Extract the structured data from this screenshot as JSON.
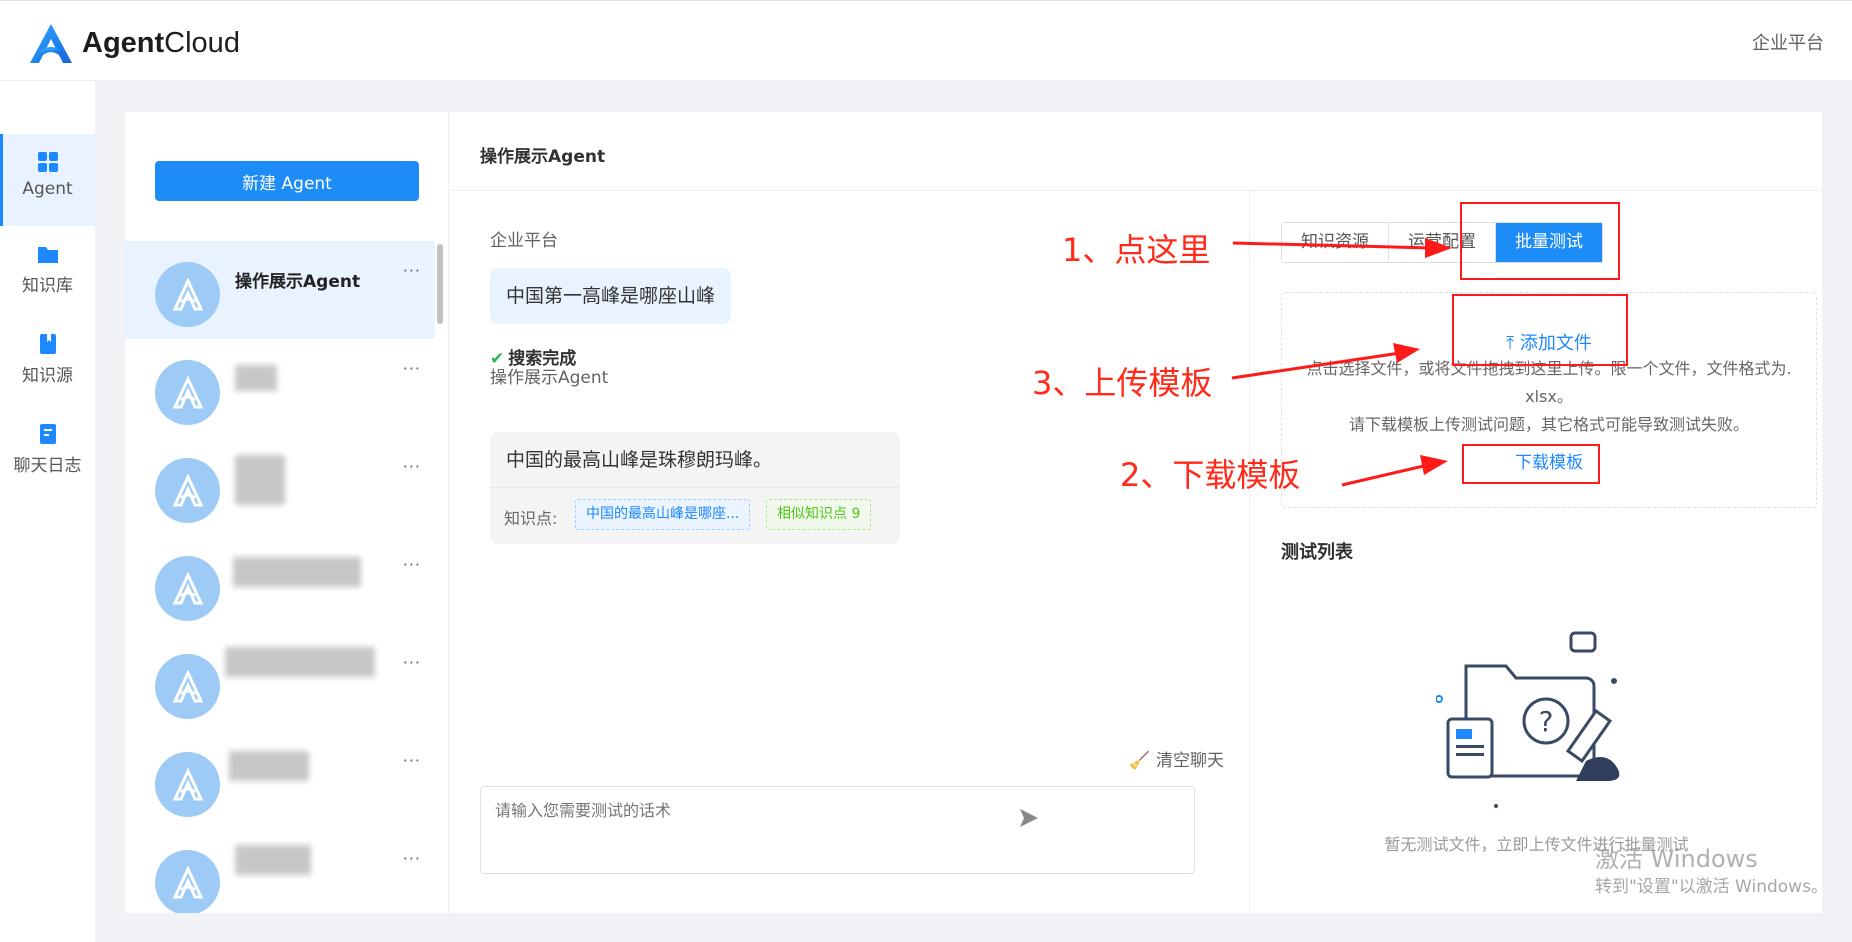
{
  "app": {
    "logo_bold": "Agent",
    "logo_light": "Cloud",
    "header_right": "企业平台"
  },
  "rail": [
    {
      "label": "Agent",
      "icon": "grid-icon"
    },
    {
      "label": "知识库",
      "icon": "folder-icon"
    },
    {
      "label": "知识源",
      "icon": "book-icon"
    },
    {
      "label": "聊天日志",
      "icon": "log-icon"
    }
  ],
  "agents": {
    "new_button": "新建 Agent",
    "selected_name": "操作展示Agent",
    "more": "···"
  },
  "chat": {
    "title": "操作展示Agent",
    "user_sender": "企业平台",
    "user_message": "中国第一高峰是哪座山峰",
    "status": "搜索完成",
    "bot_sender": "操作展示Agent",
    "bot_message": "中国的最高山峰是珠穆朗玛峰。",
    "kp_label": "知识点:",
    "kp_tag": "中国的最高山峰是哪座...",
    "similar_tag": "相似知识点 9",
    "clear": "清空聊天",
    "input_placeholder": "请输入您需要测试的话术"
  },
  "panel": {
    "tabs": [
      "知识资源",
      "运营配置",
      "批量测试"
    ],
    "add_file": "添加文件",
    "desc_line1": "点击选择文件，或将文件拖拽到这里上传。限一个文件，文件格式为.",
    "desc_line2": "xlsx。",
    "desc_line3": "请下载模板上传测试问题，其它格式可能导致测试失败。",
    "download": "下载模板",
    "list_title": "测试列表",
    "empty": "暂无测试文件，立即上传文件进行批量测试"
  },
  "annotations": {
    "step1": "1、点这里",
    "step2": "2、下载模板",
    "step3": "3、上传模板"
  },
  "watermark": {
    "line1": "激活 Windows",
    "line2": "转到\"设置\"以激活 Windows。"
  },
  "colors": {
    "accent": "#1e8cf7",
    "annotation": "#ff1a1a",
    "success": "#2db84d"
  }
}
